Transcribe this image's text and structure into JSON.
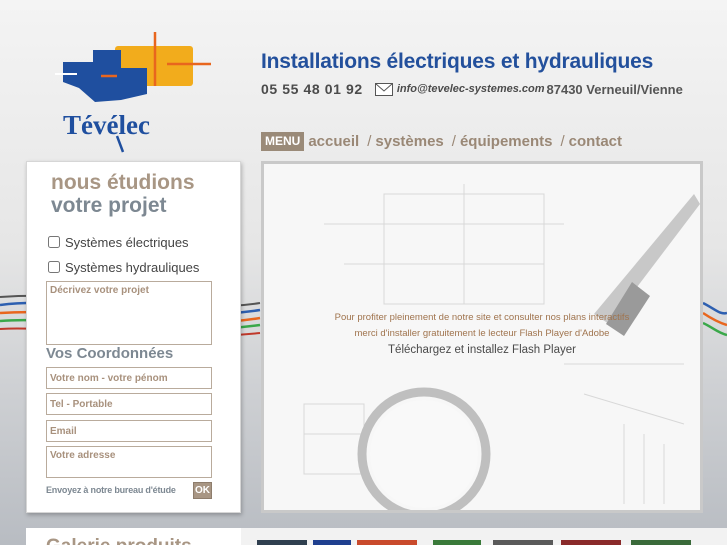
{
  "brand": {
    "logo_text": "Tévélec",
    "colors": {
      "blue": "#1f4f9f",
      "yellow": "#f2ac1c",
      "orange": "#e8661e"
    }
  },
  "header": {
    "title": "Installations électriques et hydrauliques",
    "phone": "05 55 48 01 92",
    "email": "info@tevelec-systemes.com",
    "city": "87430 Verneuil/Vienne",
    "mail_icon": "envelope-icon"
  },
  "nav": {
    "menu_label": "MENU",
    "items": [
      {
        "label": "accueil"
      },
      {
        "label": "systèmes"
      },
      {
        "label": "équipements"
      },
      {
        "label": "contact"
      }
    ],
    "separator": "/"
  },
  "form": {
    "title_line1": "nous étudions",
    "title_line2": "votre projet",
    "options": [
      {
        "label": "Systèmes électriques",
        "checked": false
      },
      {
        "label": "Systèmes hydrauliques",
        "checked": false
      }
    ],
    "project_placeholder": "Décrivez votre projet",
    "coords_title": "Vos Coordonnées",
    "name_placeholder": "Votre nom - votre pénom",
    "phone_placeholder": "Tel - Portable",
    "email_placeholder": "Email",
    "address_placeholder": "Votre adresse",
    "send_label": "Envoyez à notre bureau d'étude",
    "submit_label": "OK"
  },
  "flash": {
    "message_line1": "Pour profiter pleinement de notre site et consulter nos plans interactifs",
    "message_line2": "merci d'installer gratuitement le lecteur Flash Player d'Adobe",
    "link_label": "Téléchargez et installez Flash Player"
  },
  "gallery": {
    "title": "Galerie produits"
  }
}
